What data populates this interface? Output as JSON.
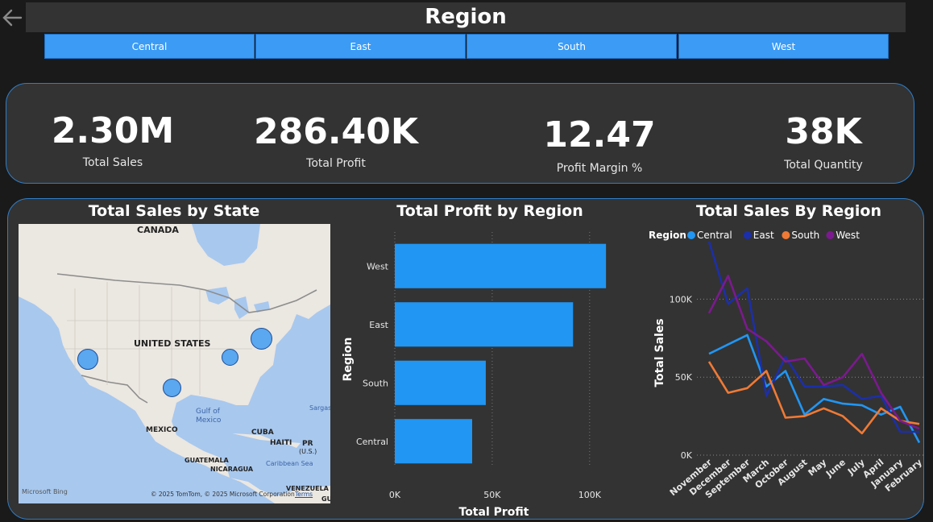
{
  "page": {
    "title": "Region",
    "slicer": [
      "Central",
      "East",
      "South",
      "West"
    ]
  },
  "kpis": [
    {
      "value": "2.30M",
      "label": "Total Sales"
    },
    {
      "value": "286.40K",
      "label": "Total Profit"
    },
    {
      "value": "12.47",
      "label": "Profit Margin %"
    },
    {
      "value": "38K",
      "label": "Total Quantity"
    }
  ],
  "map": {
    "title": "Total Sales by State",
    "labels": {
      "canada": "CANADA",
      "us": "UNITED STATES",
      "mexico": "MEXICO",
      "gulf1": "Gulf of",
      "gulf2": "Mexico",
      "cuba": "CUBA",
      "haiti": "HAITI",
      "pr": "PR",
      "pr2": "(U.S.)",
      "guatemala": "GUATEMALA",
      "nicaragua": "NICARAGUA",
      "caribbean": "Caribbean Sea",
      "venezuela": "VENEZUELA",
      "sargas": "Sargas",
      "gu": "GU",
      "bing": "Microsoft Bing",
      "copyright": "© 2025 TomTom, © 2025 Microsoft Corporation",
      "terms": "Terms"
    },
    "colors": {
      "water": "#a8c8ee",
      "land": "#ebe7e1",
      "bubble": "#5ba7f0"
    }
  },
  "chart_data": [
    {
      "type": "bar",
      "orientation": "horizontal",
      "title": "Total Profit by Region",
      "xlabel": "Total Profit",
      "ylabel": "Region",
      "categories": [
        "West",
        "East",
        "South",
        "Central"
      ],
      "values": [
        108400,
        91500,
        46700,
        39700
      ],
      "xlim": [
        0,
        110000
      ],
      "xticks": [
        "0K",
        "50K",
        "100K"
      ],
      "color": "#2196f3",
      "grid": true
    },
    {
      "type": "line",
      "title": "Total Sales By Region",
      "ylabel": "Total Sales",
      "legend_title": "Region",
      "legend_position": "top",
      "x": [
        "November",
        "December",
        "September",
        "March",
        "October",
        "August",
        "May",
        "June",
        "July",
        "April",
        "January",
        "February"
      ],
      "ylim": [
        0,
        140000
      ],
      "yticks": [
        "0K",
        "50K",
        "100K"
      ],
      "series": [
        {
          "name": "Central",
          "color": "#2196f3",
          "values": [
            65000,
            71000,
            77000,
            44000,
            54000,
            26000,
            36000,
            33000,
            32000,
            26000,
            31000,
            8000
          ]
        },
        {
          "name": "East",
          "color": "#1c2fa8",
          "values": [
            137000,
            97000,
            107000,
            38000,
            63000,
            44000,
            44000,
            45000,
            36000,
            38000,
            15000,
            15000
          ]
        },
        {
          "name": "South",
          "color": "#f07a35",
          "values": [
            60000,
            40000,
            43000,
            54000,
            24000,
            25000,
            30000,
            25000,
            14000,
            30000,
            22000,
            20000
          ]
        },
        {
          "name": "West",
          "color": "#7b1a8e",
          "values": [
            91000,
            115000,
            81000,
            73000,
            60000,
            62000,
            45000,
            50000,
            65000,
            40000,
            22000,
            17000
          ]
        }
      ],
      "grid": true
    }
  ]
}
